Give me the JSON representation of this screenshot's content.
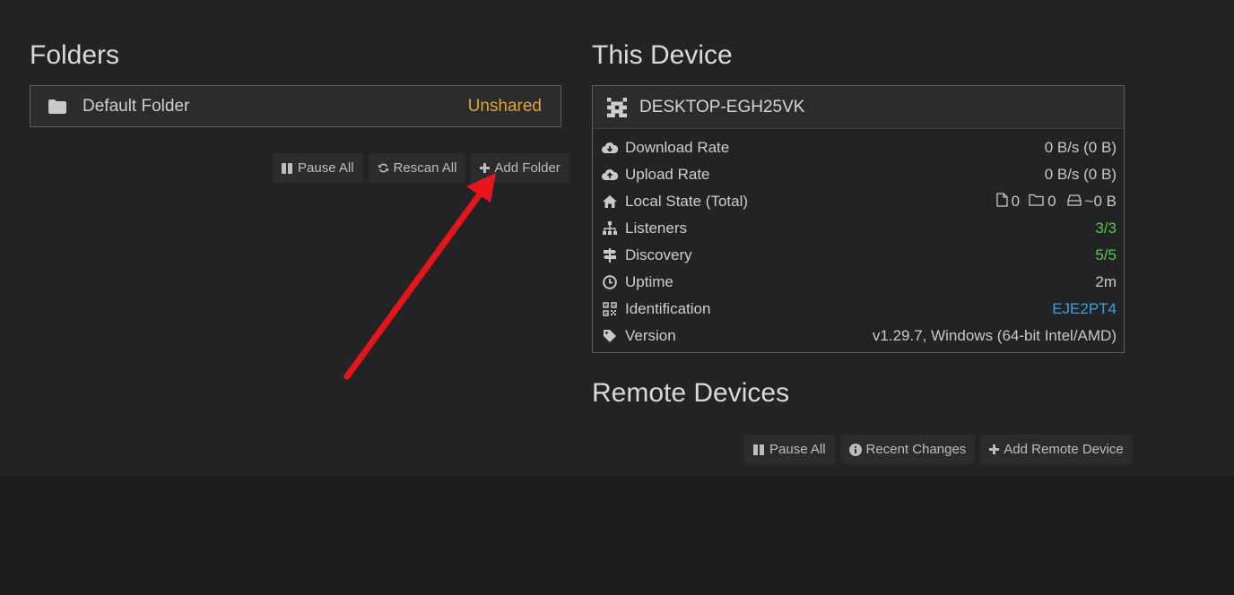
{
  "folders": {
    "title": "Folders",
    "items": [
      {
        "name": "Default Folder",
        "status": "Unshared",
        "icon": "folder-icon"
      }
    ],
    "buttons": {
      "pause_all": "Pause All",
      "rescan_all": "Rescan All",
      "add_folder": "Add Folder"
    }
  },
  "this_device": {
    "title": "This Device",
    "name": "DESKTOP-EGH25VK",
    "rows": [
      {
        "label": "Download Rate",
        "value": "0 B/s (0 B)",
        "icon": "cloud-download-icon"
      },
      {
        "label": "Upload Rate",
        "value": "0 B/s (0 B)",
        "icon": "cloud-upload-icon"
      },
      {
        "label": "Local State (Total)",
        "files": "0",
        "dirs": "0",
        "size": "~0 B",
        "icon": "home-icon"
      },
      {
        "label": "Listeners",
        "value": "3/3",
        "icon": "sitemap-icon"
      },
      {
        "label": "Discovery",
        "value": "5/5",
        "icon": "signpost-icon"
      },
      {
        "label": "Uptime",
        "value": "2m",
        "icon": "clock-icon"
      },
      {
        "label": "Identification",
        "value": "EJE2PT4",
        "icon": "qrcode-icon"
      },
      {
        "label": "Version",
        "value": "v1.29.7, Windows (64-bit Intel/AMD)",
        "icon": "tag-icon"
      }
    ]
  },
  "remote_devices": {
    "title": "Remote Devices",
    "buttons": {
      "pause_all": "Pause All",
      "recent_changes": "Recent Changes",
      "add_remote_device": "Add Remote Device"
    }
  },
  "colors": {
    "accent_orange": "#e8a32b",
    "status_green": "#55c755",
    "link_blue": "#3c9ee0",
    "annotation_red": "#e8141b"
  }
}
